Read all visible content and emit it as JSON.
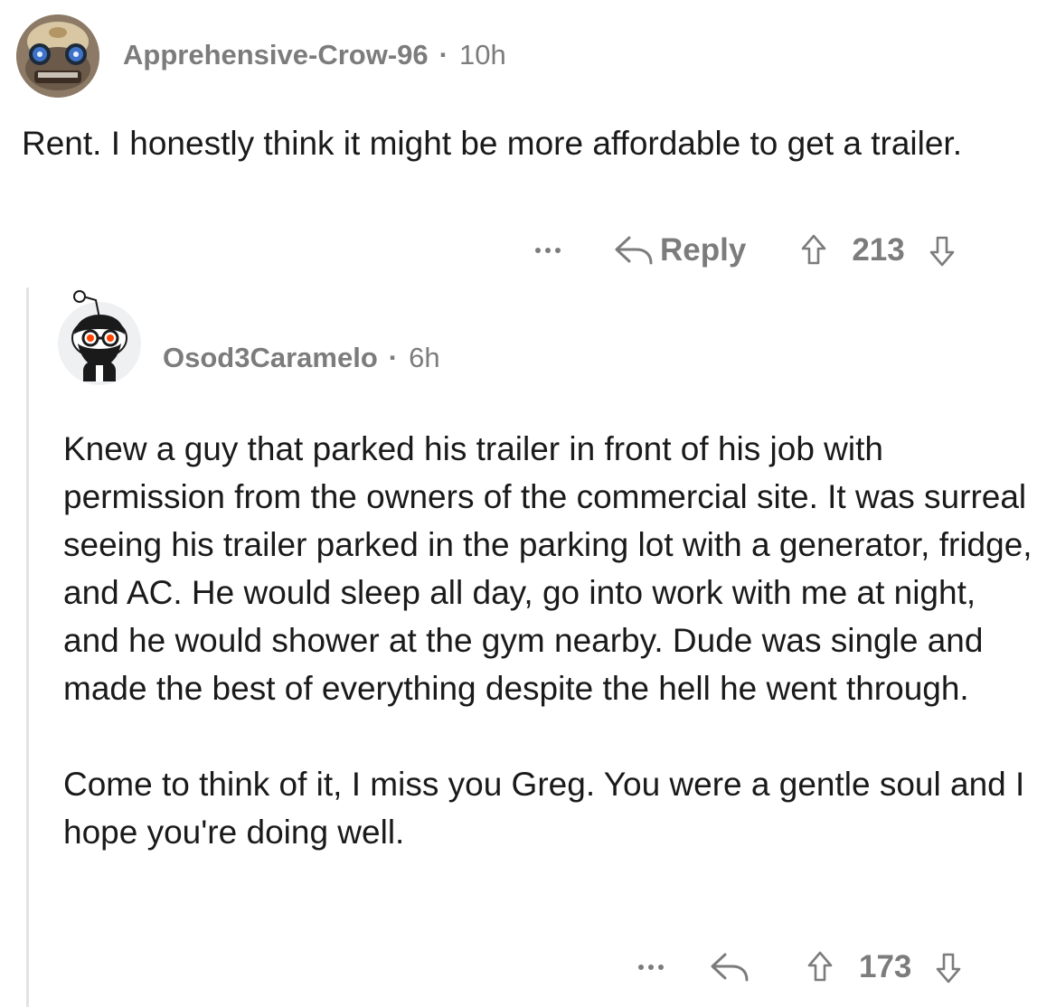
{
  "comment": {
    "username": "Apprehensive-Crow-96",
    "separator": "·",
    "time": "10h",
    "body": "Rent. I honestly think it might be more affordable to get a trailer.",
    "actions": {
      "more_icon": "more-dots-icon",
      "reply_label": "Reply",
      "reply_icon": "reply-arrow-icon",
      "upvote_icon": "upvote-arrow-icon",
      "score": "213",
      "downvote_icon": "downvote-arrow-icon"
    }
  },
  "reply": {
    "username": "Osod3Caramelo",
    "separator": "·",
    "time": "6h",
    "paragraphs": [
      "Knew a guy that parked his trailer in front of his job with permission from the owners of the commercial site. It was surreal seeing his trailer parked in the parking lot with a generator, fridge, and AC. He would sleep all day, go into work with me at night, and he would shower at the gym nearby. Dude was single and made the best of everything despite the hell he went through.",
      "Come to think of it, I miss you Greg. You were a gentle soul and I hope you're doing well."
    ],
    "actions": {
      "more_icon": "more-dots-icon",
      "reply_icon": "reply-arrow-icon",
      "upvote_icon": "upvote-arrow-icon",
      "score": "173",
      "downvote_icon": "downvote-arrow-icon"
    }
  },
  "colors": {
    "text": "#1a1a1b",
    "meta": "#7c7c7c",
    "thread_line": "#e3e3e3",
    "background": "#ffffff"
  }
}
